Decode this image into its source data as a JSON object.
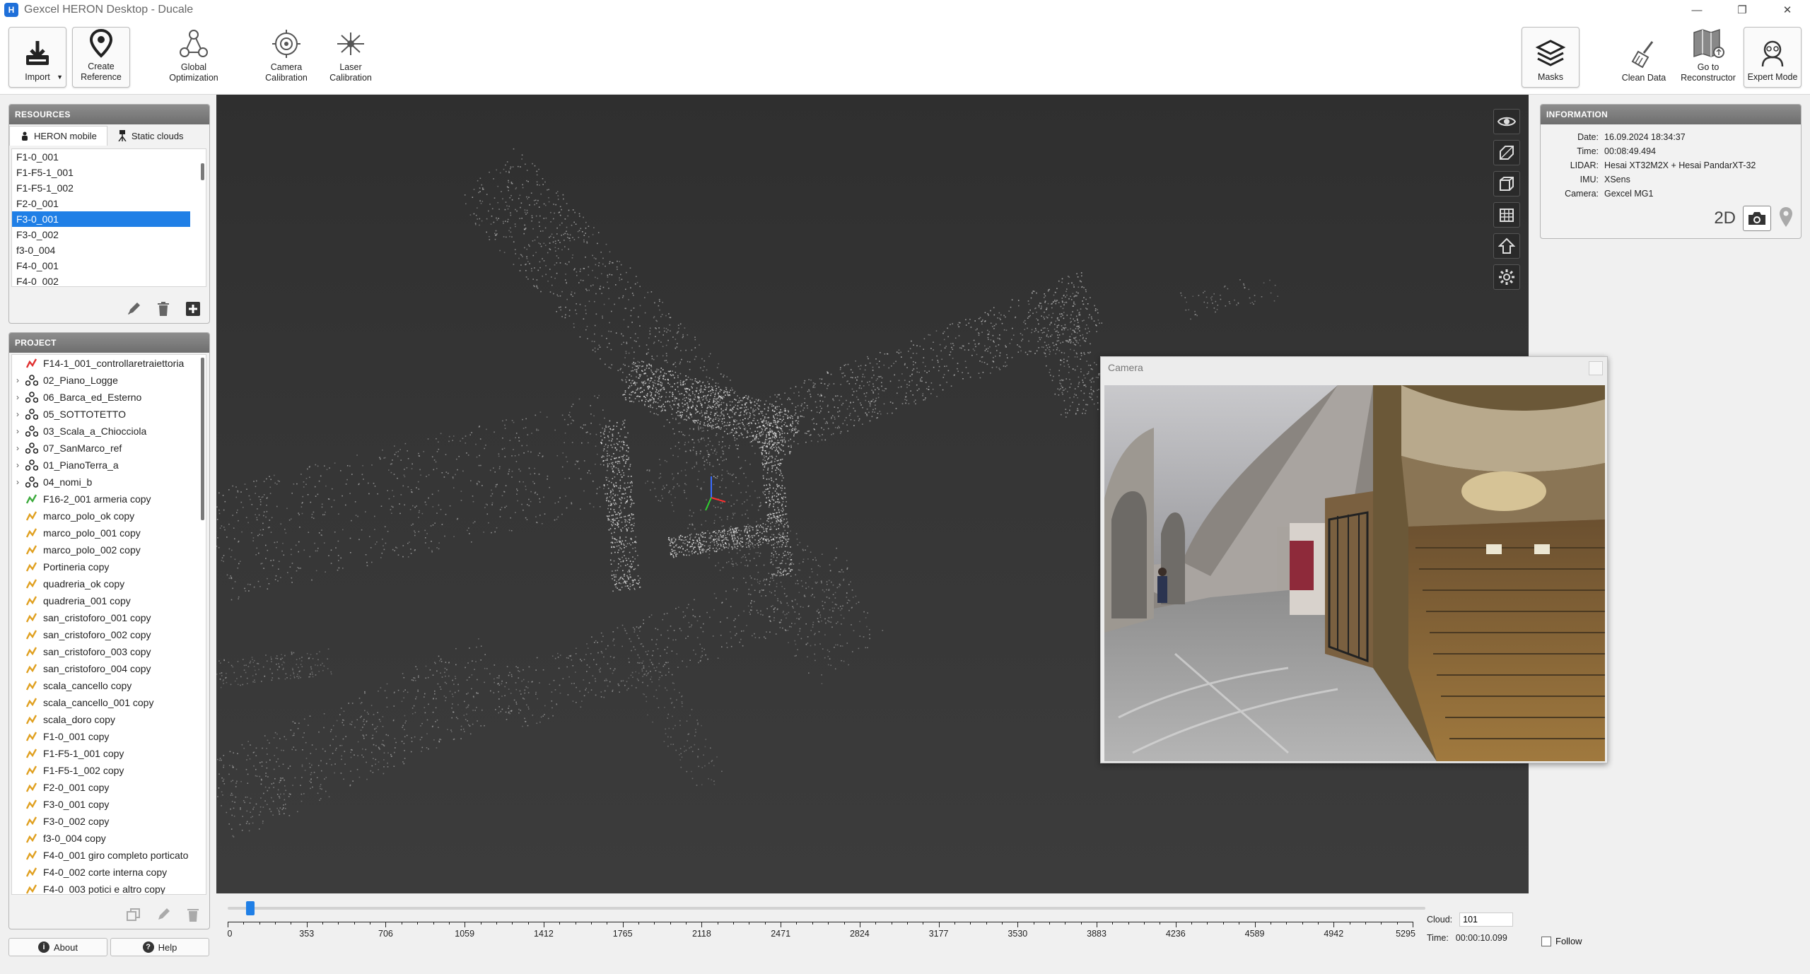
{
  "window": {
    "title": "Gexcel HERON Desktop - Ducale",
    "app_icon": "heron-app-icon"
  },
  "toolbar": {
    "import": "Import",
    "create_reference": "Create\nReference",
    "global_optimization": "Global\nOptimization",
    "camera_calibration": "Camera\nCalibration",
    "laser_calibration": "Laser\nCalibration",
    "masks": "Masks",
    "clean_data": "Clean Data",
    "go_to_reconstructor": "Go to\nReconstructor",
    "expert_mode": "Expert Mode"
  },
  "resources": {
    "title": "RESOURCES",
    "tabs": [
      "HERON mobile",
      "Static clouds"
    ],
    "items": [
      "F1-0_001",
      "F1-F5-1_001",
      "F1-F5-1_002",
      "F2-0_001",
      "F3-0_001",
      "F3-0_002",
      "f3-0_004",
      "F4-0_001",
      "F4-0_002"
    ],
    "selected": "F3-0_001"
  },
  "project": {
    "title": "PROJECT",
    "items": [
      {
        "label": "F14-1_001_controllaretraiettoria",
        "type": "trajectory-red",
        "expandable": false
      },
      {
        "label": "02_Piano_Logge",
        "type": "group",
        "expandable": true
      },
      {
        "label": "06_Barca_ed_Esterno",
        "type": "group",
        "expandable": true
      },
      {
        "label": "05_SOTTOTETTO",
        "type": "group",
        "expandable": true
      },
      {
        "label": "03_Scala_a_Chiocciola",
        "type": "group",
        "expandable": true
      },
      {
        "label": "07_SanMarco_ref",
        "type": "group",
        "expandable": true
      },
      {
        "label": "01_PianoTerra_a",
        "type": "group",
        "expandable": true
      },
      {
        "label": "04_nomi_b",
        "type": "group",
        "expandable": true
      },
      {
        "label": "F16-2_001 armeria copy",
        "type": "trajectory-green",
        "expandable": false
      },
      {
        "label": "marco_polo_ok copy",
        "type": "trajectory-yellow",
        "expandable": false
      },
      {
        "label": "marco_polo_001 copy",
        "type": "trajectory-yellow",
        "expandable": false
      },
      {
        "label": "marco_polo_002 copy",
        "type": "trajectory-yellow",
        "expandable": false
      },
      {
        "label": "Portineria copy",
        "type": "trajectory-yellow",
        "expandable": false
      },
      {
        "label": "quadreria_ok copy",
        "type": "trajectory-yellow",
        "expandable": false
      },
      {
        "label": "quadreria_001 copy",
        "type": "trajectory-yellow",
        "expandable": false
      },
      {
        "label": "san_cristoforo_001 copy",
        "type": "trajectory-yellow",
        "expandable": false
      },
      {
        "label": "san_cristoforo_002 copy",
        "type": "trajectory-yellow",
        "expandable": false
      },
      {
        "label": "san_cristoforo_003 copy",
        "type": "trajectory-yellow",
        "expandable": false
      },
      {
        "label": "san_cristoforo_004 copy",
        "type": "trajectory-yellow",
        "expandable": false
      },
      {
        "label": "scala_cancello copy",
        "type": "trajectory-yellow",
        "expandable": false
      },
      {
        "label": "scala_cancello_001 copy",
        "type": "trajectory-yellow",
        "expandable": false
      },
      {
        "label": "scala_doro copy",
        "type": "trajectory-yellow",
        "expandable": false
      },
      {
        "label": "F1-0_001 copy",
        "type": "trajectory-yellow",
        "expandable": false
      },
      {
        "label": "F1-F5-1_001 copy",
        "type": "trajectory-yellow",
        "expandable": false
      },
      {
        "label": "F1-F5-1_002 copy",
        "type": "trajectory-yellow",
        "expandable": false
      },
      {
        "label": "F2-0_001 copy",
        "type": "trajectory-yellow",
        "expandable": false
      },
      {
        "label": "F3-0_001 copy",
        "type": "trajectory-yellow",
        "expandable": false
      },
      {
        "label": "F3-0_002 copy",
        "type": "trajectory-yellow",
        "expandable": false
      },
      {
        "label": "f3-0_004 copy",
        "type": "trajectory-yellow",
        "expandable": false
      },
      {
        "label": "F4-0_001 giro completo porticato",
        "type": "trajectory-yellow",
        "expandable": false
      },
      {
        "label": "F4-0_002 corte interna copy",
        "type": "trajectory-yellow",
        "expandable": false
      },
      {
        "label": "F4-0_003 potici e altro copy",
        "type": "trajectory-yellow",
        "expandable": false
      }
    ]
  },
  "bottom": {
    "about": "About",
    "help": "Help"
  },
  "information": {
    "title": "INFORMATION",
    "rows": [
      {
        "key": "Date:",
        "value": "16.09.2024 18:34:37"
      },
      {
        "key": "Time:",
        "value": "00:08:49.494"
      },
      {
        "key": "LIDAR:",
        "value": "Hesai XT32M2X + Hesai PandarXT-32"
      },
      {
        "key": "IMU:",
        "value": "XSens"
      },
      {
        "key": "Camera:",
        "value": "Gexcel MG1"
      }
    ],
    "mode_2d": "2D"
  },
  "camera_window": {
    "title": "Camera"
  },
  "timeline": {
    "ticks": [
      "0",
      "353",
      "706",
      "1059",
      "1412",
      "1765",
      "2118",
      "2471",
      "2824",
      "3177",
      "3530",
      "3883",
      "4236",
      "4589",
      "4942",
      "5295"
    ],
    "max": 5295,
    "position": 101,
    "cloud_label": "Cloud:",
    "cloud_value": "101",
    "time_label": "Time:",
    "time_value": "00:00:10.099",
    "follow_label": "Follow"
  },
  "colors": {
    "accent": "#1f7fe6",
    "viewport_bg": "#333333",
    "trajectory_red": "#e03030",
    "trajectory_green": "#3caa3c",
    "trajectory_yellow": "#e0a020"
  }
}
